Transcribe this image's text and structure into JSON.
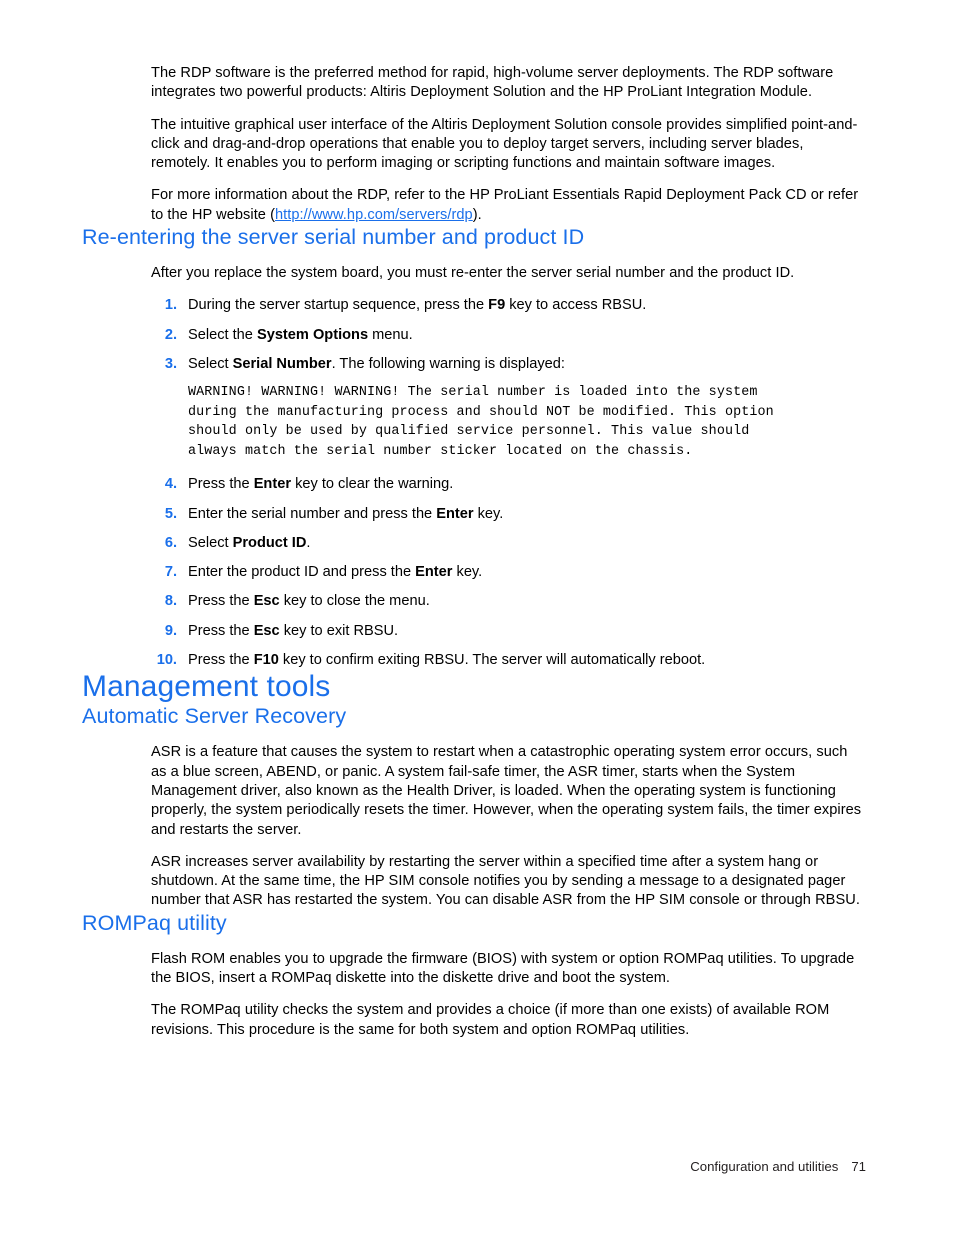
{
  "document": {
    "intro_paragraphs": [
      "The RDP software is the preferred method for rapid, high-volume server deployments. The RDP software integrates two powerful products: Altiris Deployment Solution and the HP ProLiant Integration Module.",
      "The intuitive graphical user interface of the Altiris Deployment Solution console provides simplified point-and-click and drag-and-drop operations that enable you to deploy target servers, including server blades, remotely. It enables you to perform imaging or scripting functions and maintain software images."
    ],
    "rdp_reference": {
      "before_link": "For more information about the RDP, refer to the HP ProLiant Essentials Rapid Deployment Pack CD or refer to the HP website (",
      "link_text": "http://www.hp.com/servers/rdp",
      "after_link": ")."
    },
    "section_serial": {
      "heading": "Re-entering the server serial number and product ID",
      "intro": "After you replace the system board, you must re-enter the server serial number and the product ID.",
      "steps": [
        {
          "num": "1.",
          "pre": "During the server startup sequence, press the ",
          "bold": "F9",
          "post": " key to access RBSU."
        },
        {
          "num": "2.",
          "pre": "Select the ",
          "bold": "System Options",
          "post": " menu."
        },
        {
          "num": "3.",
          "pre": "Select ",
          "bold": "Serial Number",
          "post": ". The following warning is displayed:"
        },
        {
          "num": "4.",
          "pre": "Press the ",
          "bold": "Enter",
          "post": " key to clear the warning."
        },
        {
          "num": "5.",
          "pre": "Enter the serial number and press the ",
          "bold": "Enter",
          "post": " key."
        },
        {
          "num": "6.",
          "pre": "Select ",
          "bold": "Product ID",
          "post": "."
        },
        {
          "num": "7.",
          "pre": "Enter the product ID and press the ",
          "bold": "Enter",
          "post": " key."
        },
        {
          "num": "8.",
          "pre": "Press the ",
          "bold": "Esc",
          "post": " key to close the menu."
        },
        {
          "num": "9.",
          "pre": "Press the ",
          "bold": "Esc",
          "post": " key to exit RBSU."
        },
        {
          "num": "10.",
          "pre": "Press the ",
          "bold": "F10",
          "post": " key to confirm exiting RBSU. The server will automatically reboot."
        }
      ],
      "warning_block": "WARNING! WARNING! WARNING! The serial number is loaded into the system\nduring the manufacturing process and should NOT be modified. This option\nshould only be used by qualified service personnel. This value should\nalways match the serial number sticker located on the chassis."
    },
    "section_management": {
      "heading": "Management tools",
      "asr": {
        "heading": "Automatic Server Recovery",
        "paragraphs": [
          "ASR is a feature that causes the system to restart when a catastrophic operating system error occurs, such as a blue screen, ABEND, or panic. A system fail-safe timer, the ASR timer, starts when the System Management driver, also known as the Health Driver, is loaded. When the operating system is functioning properly, the system periodically resets the timer. However, when the operating system fails, the timer expires and restarts the server.",
          "ASR increases server availability by restarting the server within a specified time after a system hang or shutdown. At the same time, the HP SIM console notifies you by sending a message to a designated pager number that ASR has restarted the system. You can disable ASR from the HP SIM console or through RBSU."
        ]
      },
      "rompaq": {
        "heading": "ROMPaq utility",
        "paragraphs": [
          "Flash ROM enables you to upgrade the firmware (BIOS) with system or option ROMPaq utilities. To upgrade the BIOS, insert a ROMPaq diskette into the diskette drive and boot the system.",
          "The ROMPaq utility checks the system and provides a choice (if more than one exists) of available ROM revisions. This procedure is the same for both system and option ROMPaq utilities."
        ]
      }
    },
    "footer": {
      "chapter": "Configuration and utilities",
      "page_number": "71"
    },
    "colors": {
      "heading_blue": "#1a6fea",
      "link_blue": "#1a6fea",
      "body_black": "#000000"
    }
  }
}
